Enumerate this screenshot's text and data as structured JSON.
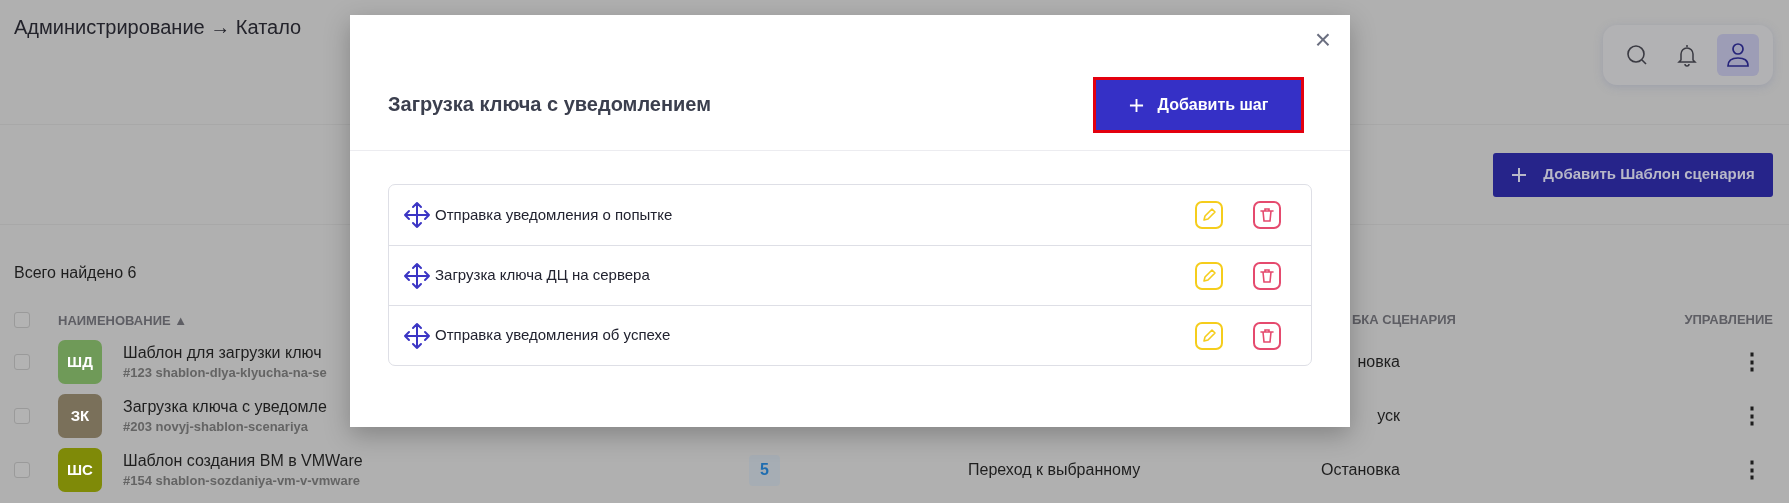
{
  "breadcrumb": "Администрирование → Катало",
  "add_template_button": "Добавить Шаблон сценария",
  "total_found": "Всего найдено 6",
  "table": {
    "header_checkbox": {
      "checked": false
    },
    "name_header": "НАИМЕНОВАНИЕ ▲",
    "status_header": "БКА СЦЕНАРИЯ",
    "actions_header": "УПРАВЛЕНИЕ",
    "rows": [
      {
        "checked": false,
        "avatar": "ШД",
        "color": "#6f9a58",
        "name": "Шаблон для загрузки ключ",
        "slug": "#123 shablon-dlya-klyucha-na-se",
        "status": "новка",
        "menu": "⋮"
      },
      {
        "checked": false,
        "avatar": "ЗК",
        "color": "#7a705a",
        "name": "Загрузка ключа с уведомле",
        "slug": "#203 novyj-shablon-scenariya",
        "status": "уск",
        "menu": "⋮"
      },
      {
        "checked": false,
        "avatar": "ШС",
        "color": "#7f8a08",
        "name": "Шаблон создания ВМ в VMWare",
        "slug": "#154 shablon-sozdaniya-vm-v-vmware",
        "steps": "5",
        "transition": "Переход к выбранному",
        "status": "Остановка",
        "menu": "⋮"
      }
    ]
  },
  "modal": {
    "title": "Загрузка ключа с уведомлением",
    "close": "×",
    "add_step_button": "Добавить шаг",
    "steps": [
      {
        "label": "Отправка уведомления о попытке"
      },
      {
        "label": "Загрузка ключа ДЦ на сервера"
      },
      {
        "label": "Отправка уведомления об успехе"
      }
    ]
  }
}
